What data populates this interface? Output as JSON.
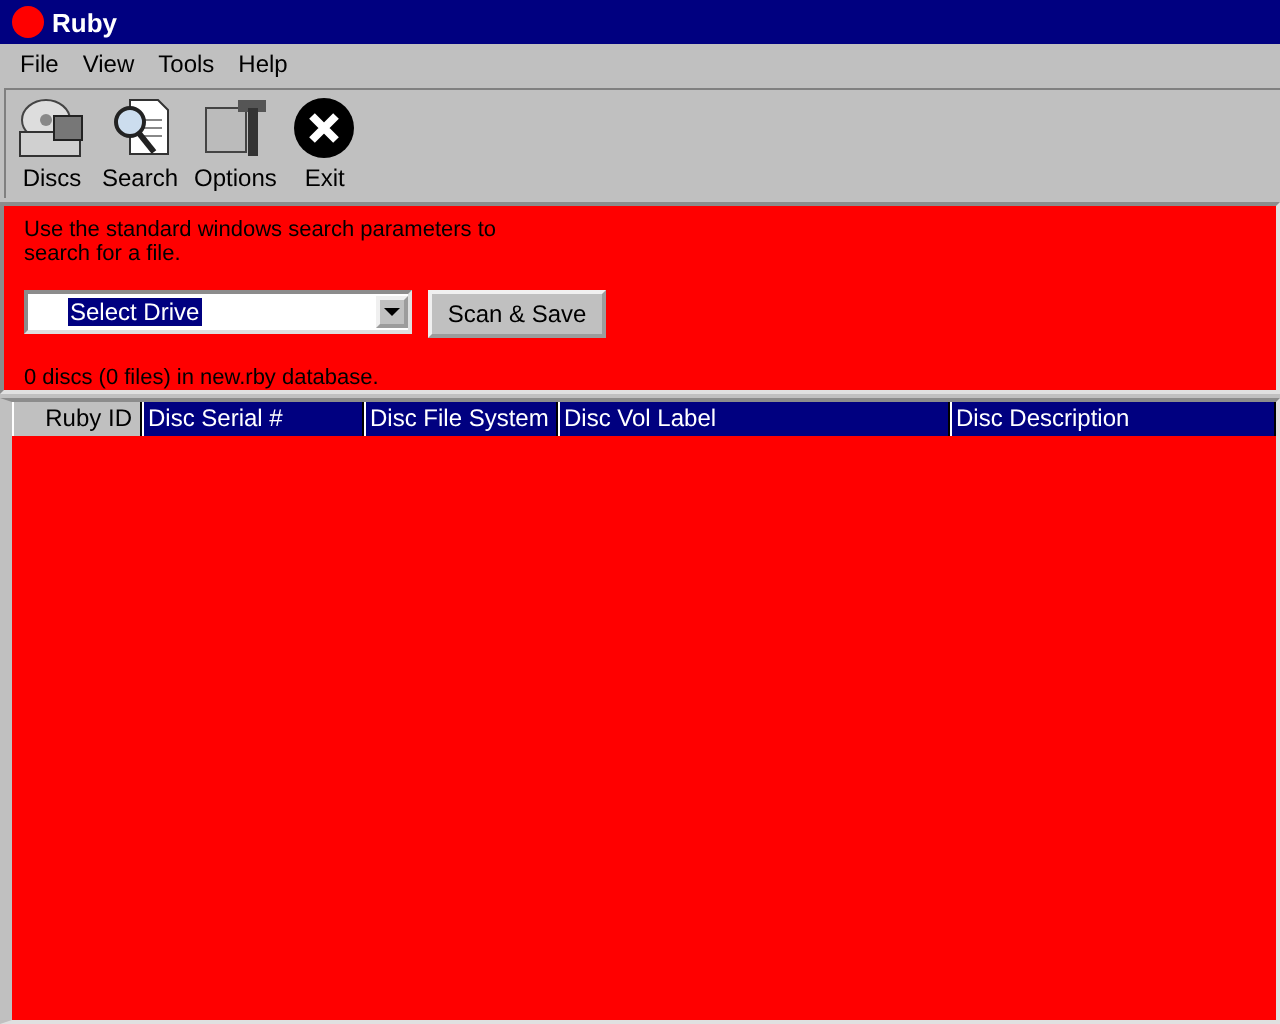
{
  "window": {
    "title": "Ruby"
  },
  "menu": [
    "File",
    "View",
    "Tools",
    "Help"
  ],
  "toolbar": [
    {
      "kind": "discs",
      "label": "Discs"
    },
    {
      "kind": "search",
      "label": "Search"
    },
    {
      "kind": "options",
      "label": "Options"
    },
    {
      "kind": "exit",
      "label": "Exit"
    }
  ],
  "search_panel": {
    "hint": "Use the standard windows search parameters to search for a file.",
    "drive_select": {
      "value": "Select Drive"
    },
    "scan_button": "Scan & Save",
    "status": "0 discs (0 files) in new.rby database."
  },
  "table": {
    "columns": [
      {
        "label": "Ruby ID",
        "selected": true
      },
      {
        "label": "Disc Serial #",
        "selected": false
      },
      {
        "label": "Disc File System",
        "selected": false
      },
      {
        "label": "Disc Vol Label",
        "selected": false
      },
      {
        "label": "Disc Description",
        "selected": false
      }
    ]
  }
}
